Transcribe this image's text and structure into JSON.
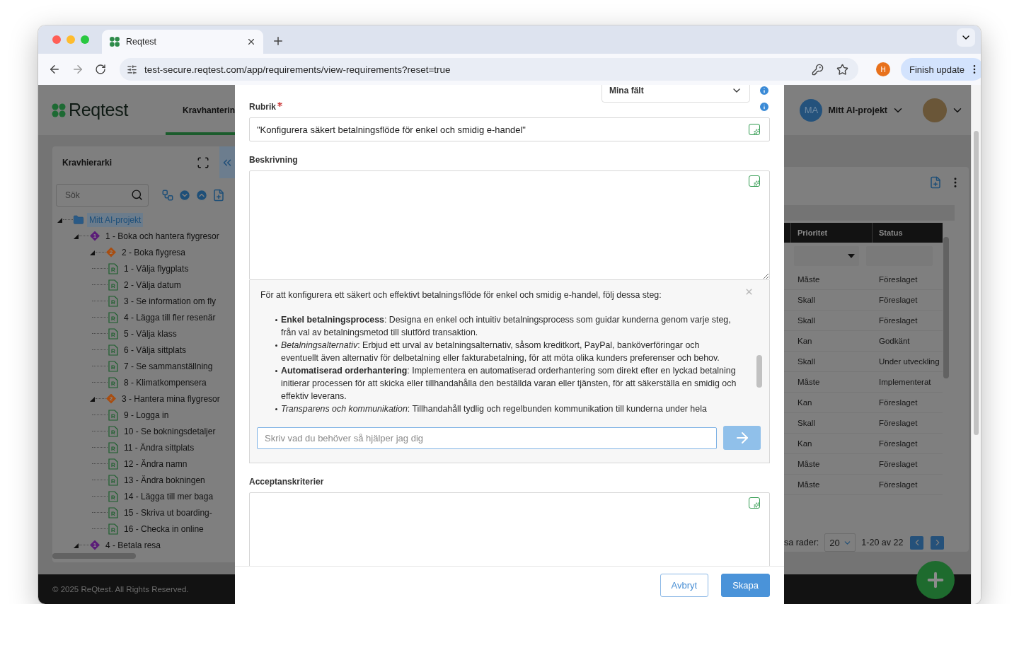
{
  "browser": {
    "tab_title": "Reqtest",
    "url": "test-secure.reqtest.com/app/requirements/view-requirements?reset=true",
    "profile_initial": "H",
    "update_button": "Finish update"
  },
  "app": {
    "logo": "Reqtest",
    "nav_tab": {
      "label": "Kravhanterin",
      "selected": true
    },
    "project": {
      "initials": "MA",
      "name": "Mitt AI-projekt"
    },
    "footer": "© 2025 ReQtest. All Rights Reserved."
  },
  "hierarchy": {
    "title": "Kravhierarki",
    "search_placeholder": "Sök",
    "tree": [
      {
        "label": "Mitt AI-projekt",
        "kind": "folder",
        "selected": true,
        "expanded": true,
        "children": [
          {
            "label": "1 - Boka och hantera flygresor",
            "kind": "group",
            "badge": "1",
            "color": "#5b1d78",
            "selected": false,
            "expanded": true,
            "children": [
              {
                "label": "2 - Boka flygresa",
                "kind": "group",
                "badge": "2",
                "color": "#a84d10",
                "selected": false,
                "expanded": true,
                "children": [
                  {
                    "label": "1 - Välja flygplats",
                    "kind": "requirement",
                    "selected": false
                  },
                  {
                    "label": "2 - Välja datum",
                    "kind": "requirement",
                    "selected": false
                  },
                  {
                    "label": "3 - Se information om fly",
                    "kind": "requirement",
                    "selected": false
                  },
                  {
                    "label": "4 - Lägga till fler resenär",
                    "kind": "requirement",
                    "selected": false
                  },
                  {
                    "label": "5 - Välja klass",
                    "kind": "requirement",
                    "selected": false
                  },
                  {
                    "label": "6 - Välja sittplats",
                    "kind": "requirement",
                    "selected": false
                  },
                  {
                    "label": "7 - Se sammanställning",
                    "kind": "requirement",
                    "selected": false
                  },
                  {
                    "label": "8 - Klimatkompensera",
                    "kind": "requirement",
                    "selected": false
                  }
                ]
              },
              {
                "label": "3 - Hantera mina flygresor",
                "kind": "group",
                "badge": "2",
                "color": "#a84d10",
                "selected": false,
                "expanded": true,
                "children": [
                  {
                    "label": "9 - Logga in",
                    "kind": "requirement",
                    "selected": false
                  },
                  {
                    "label": "10 - Se bokningsdetaljer",
                    "kind": "requirement",
                    "selected": false
                  },
                  {
                    "label": "11 - Ändra sittplats",
                    "kind": "requirement",
                    "selected": false
                  },
                  {
                    "label": "12 - Ändra namn",
                    "kind": "requirement",
                    "selected": false
                  },
                  {
                    "label": "13 - Ändra bokningen",
                    "kind": "requirement",
                    "selected": false
                  },
                  {
                    "label": "14 - Lägga till mer baga",
                    "kind": "requirement",
                    "selected": false
                  },
                  {
                    "label": "15 - Skriva ut boarding-",
                    "kind": "requirement",
                    "selected": false
                  },
                  {
                    "label": "16 - Checka in online",
                    "kind": "requirement",
                    "selected": false
                  }
                ]
              }
            ]
          },
          {
            "label": "4 - Betala resa",
            "kind": "group",
            "badge": "1",
            "color": "#5b1d78",
            "selected": false,
            "expanded": true
          }
        ]
      }
    ]
  },
  "table": {
    "columns": [
      "Prioritet",
      "Status"
    ],
    "rows": [
      [
        "Måste",
        "Föreslaget"
      ],
      [
        "Skall",
        "Föreslaget"
      ],
      [
        "Skall",
        "Föreslaget"
      ],
      [
        "Kan",
        "Godkänt"
      ],
      [
        "Skall",
        "Under utveckling"
      ],
      [
        "Måste",
        "Implementerat"
      ],
      [
        "Kan",
        "Föreslaget"
      ],
      [
        "Skall",
        "Föreslaget"
      ],
      [
        "Kan",
        "Föreslaget"
      ],
      [
        "Måste",
        "Föreslaget"
      ],
      [
        "Måste",
        "Föreslaget"
      ]
    ],
    "page_size_label": "sa rader:",
    "page_size": "20",
    "range": "1-20 av 22"
  },
  "dialog": {
    "view_select": "Mina fält",
    "fields": [
      {
        "kind": "input",
        "label": "Rubrik",
        "required": true,
        "info": true,
        "value": "\"Konfigurera säkert betalningsflöde för enkel och smidig e-handel\""
      },
      {
        "kind": "textarea",
        "label": "Beskrivning",
        "required": false,
        "info": false,
        "assistant": {
          "intro": "För att konfigurera ett säkert och effektivt betalningsflöde för enkel och smidig e-handel, följ dessa steg:",
          "items": [
            "**Enkel betalningsprocess**: Designa en enkel och intuitiv betalningsprocess som guidar kunderna genom varje steg, från val av betalningsmetod till slutförd transaktion.",
            "*Betalningsalternativ*: Erbjud ett urval av betalningsalternativ, såsom kreditkort, PayPal, banköverföringar och eventuellt även alternativ för delbetalning eller fakturabetalning, för att möta olika kunders preferenser och behov.",
            "**Automatiserad orderhantering**: Implementera en automatiserad orderhantering som direkt efter en lyckad betalning initierar processen för att skicka eller tillhandahålla den beställda varan eller tjänsten, för att säkerställa en smidig och effektiv leverans.",
            "*Transparens och kommunikation*: Tillhandahåll tydlig och regelbunden kommunikation till kunderna under hela"
          ],
          "placeholder": "Skriv vad du behöver så hjälper jag dig"
        }
      },
      {
        "kind": "textarea",
        "label": "Acceptanskriterier",
        "required": false,
        "info": false
      }
    ],
    "buttons": [
      {
        "label": "Avbryt",
        "kind": "secondary"
      },
      {
        "label": "Skapa",
        "kind": "primary"
      }
    ]
  }
}
